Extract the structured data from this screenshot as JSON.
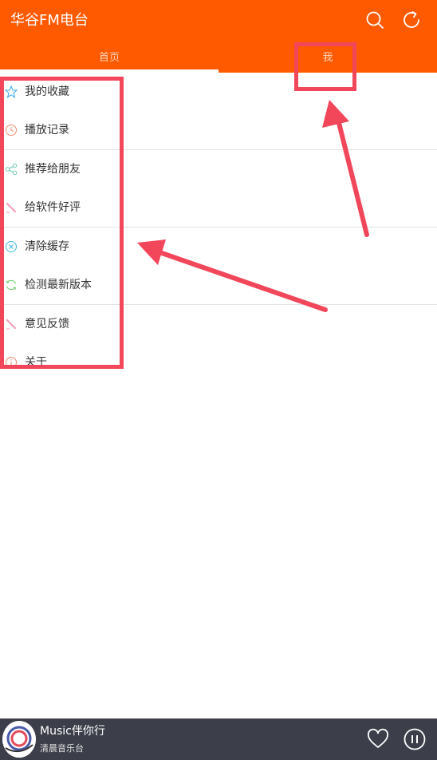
{
  "header": {
    "title": "华谷FM电台",
    "icons": [
      "search-icon",
      "refresh-icon"
    ],
    "background": "#FF5A00"
  },
  "tabs": [
    {
      "label": "首页",
      "selected": true
    },
    {
      "label": "我",
      "selected": false
    }
  ],
  "menu": {
    "groups": [
      [
        {
          "label": "我的收藏",
          "icon": "star-icon",
          "color": "#3BA9E8"
        },
        {
          "label": "播放记录",
          "icon": "clock-icon",
          "color": "#F08A6E"
        }
      ],
      [
        {
          "label": "推荐给朋友",
          "icon": "share-icon",
          "color": "#6FC7B5"
        },
        {
          "label": "给软件好评",
          "icon": "pencil-icon",
          "color": "#F2A0B5"
        }
      ],
      [
        {
          "label": "清除缓存",
          "icon": "clear-icon",
          "color": "#44B8E0"
        },
        {
          "label": "检测最新版本",
          "icon": "update-icon",
          "color": "#66CC66"
        }
      ],
      [
        {
          "label": "意见反馈",
          "icon": "pencil-icon",
          "color": "#F2A0B5"
        },
        {
          "label": "关于",
          "icon": "info-icon",
          "color": "#F08A6E"
        }
      ]
    ]
  },
  "player": {
    "title": "Music伴你行",
    "subtitle": "清晨音乐台",
    "icons": [
      "album-art",
      "heart-icon",
      "pause-icon"
    ],
    "background": "#3C3F4A"
  },
  "annotation_color": "#F2465B"
}
